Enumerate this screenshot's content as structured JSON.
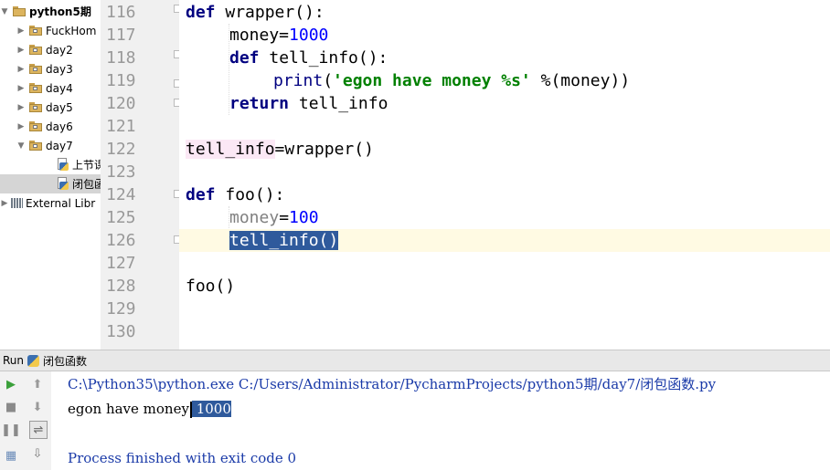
{
  "tree": {
    "root": "python5期",
    "folders": [
      "FuckHom",
      "day2",
      "day3",
      "day4",
      "day5",
      "day6",
      "day7"
    ],
    "files": [
      "上节课",
      "闭包函"
    ],
    "libs": "External Libr"
  },
  "editor": {
    "lines": [
      {
        "num": "116"
      },
      {
        "num": "117"
      },
      {
        "num": "118"
      },
      {
        "num": "119"
      },
      {
        "num": "120"
      },
      {
        "num": "121"
      },
      {
        "num": "122"
      },
      {
        "num": "123"
      },
      {
        "num": "124"
      },
      {
        "num": "125"
      },
      {
        "num": "126"
      },
      {
        "num": "127"
      },
      {
        "num": "128"
      },
      {
        "num": "129"
      },
      {
        "num": "130"
      }
    ],
    "code": {
      "l116_kw": "def",
      "l116_rest": " wrapper():",
      "l117_a": "money=",
      "l117_n": "1000",
      "l118_kw": "def",
      "l118_rest": " tell_info():",
      "l119_fn": "print",
      "l119_p": "(",
      "l119_s": "'egon have money %s'",
      "l119_rest": " %(money))",
      "l120_kw": "return",
      "l120_rest": " tell_info",
      "l122_a": "tell_info",
      "l122_rest": "=wrapper()",
      "l124_kw": "def",
      "l124_rest": " foo():",
      "l125_a": "money",
      "l125_eq": "=",
      "l125_n": "100",
      "l126_sel": "tell_info()",
      "l128": "foo()"
    }
  },
  "run": {
    "label": "Run",
    "tab": "闭包函数",
    "console": {
      "cmd": "C:\\Python35\\python.exe C:/Users/Administrator/PycharmProjects/python5期/day7/闭包函数.py",
      "out_a": "egon have money",
      "out_b": " 1000",
      "exit": "Process finished with exit code 0"
    }
  },
  "colors": {
    "keyword": "#000080",
    "string": "#008000",
    "number": "#0000ff",
    "selection": "#2f5a9c",
    "console_blue": "#1a3aa8"
  }
}
